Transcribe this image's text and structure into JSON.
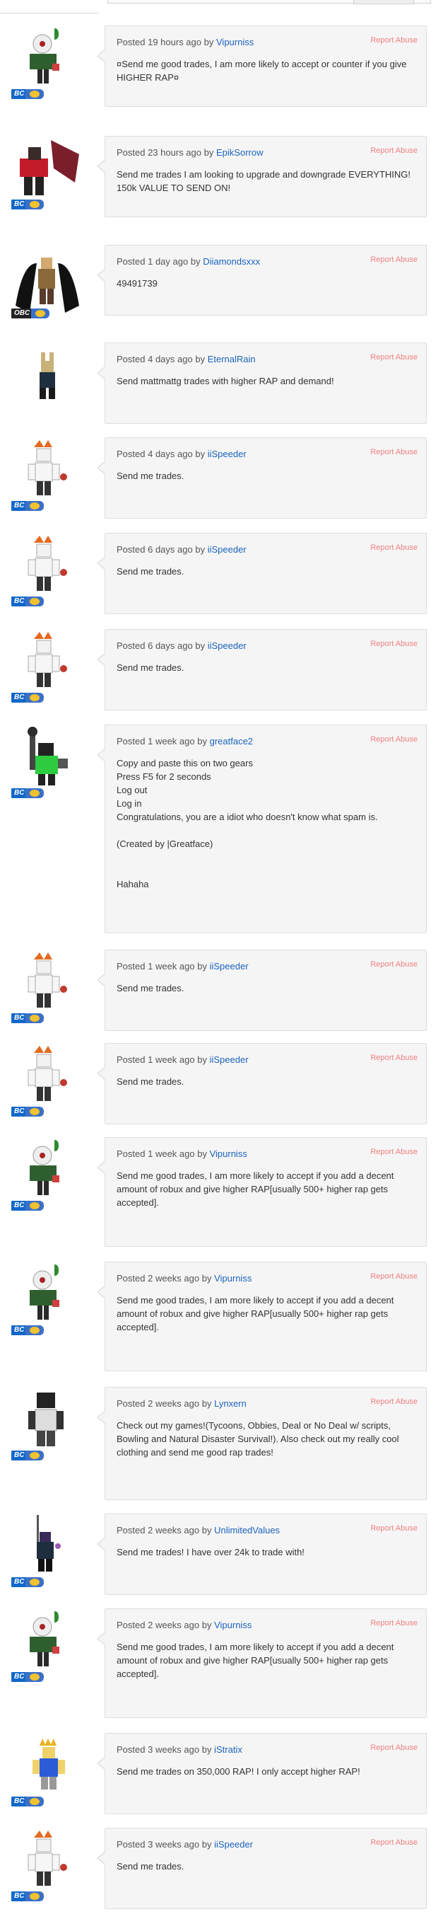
{
  "report_label": "Report Abuse",
  "posted_prefix": "Posted",
  "by_word": "by",
  "posts": [
    {
      "time": "19 hours ago",
      "user": "Vipurniss",
      "badge": "BC",
      "message": "¤Send me good trades, I am more likely to accept or counter if you give HIGHER RAP¤"
    },
    {
      "time": "23 hours ago",
      "user": "EpikSorrow",
      "badge": "BC",
      "message": "Send me trades I am looking to upgrade and downgrade EVERYTHING! 150k VALUE TO SEND ON!"
    },
    {
      "time": "1 day ago",
      "user": "Diiamondsxxx",
      "badge": "OBC",
      "message": "49491739"
    },
    {
      "time": "4 days ago",
      "user": "EternalRain",
      "badge": "",
      "message": "Send mattmattg trades with higher RAP and demand!"
    },
    {
      "time": "4 days ago",
      "user": "iiSpeeder",
      "badge": "BC",
      "message": "Send me trades."
    },
    {
      "time": "6 days ago",
      "user": "iiSpeeder",
      "badge": "BC",
      "message": "Send me trades."
    },
    {
      "time": "6 days ago",
      "user": "iiSpeeder",
      "badge": "BC",
      "message": "Send me trades."
    },
    {
      "time": "1 week ago",
      "user": "greatface2",
      "badge": "BC",
      "message": "Copy and paste this on two gears\nPress F5 for 2 seconds\nLog out\nLog in\nCongratulations, you are a idiot who doesn't know what spam is.\n\n(Created by |Greatface)\n\n\nHahaha"
    },
    {
      "time": "1 week ago",
      "user": "iiSpeeder",
      "badge": "BC",
      "message": "Send me trades."
    },
    {
      "time": "1 week ago",
      "user": "iiSpeeder",
      "badge": "BC",
      "message": "Send me trades."
    },
    {
      "time": "1 week ago",
      "user": "Vipurniss",
      "badge": "BC",
      "message": "Send me good trades, I am more likely to accept if you add a decent amount of robux and give higher RAP[usually 500+ higher rap gets accepted]."
    },
    {
      "time": "2 weeks ago",
      "user": "Vipurniss",
      "badge": "BC",
      "message": "Send me good trades, I am more likely to accept if you add a decent amount of robux and give higher RAP[usually 500+ higher rap gets accepted]."
    },
    {
      "time": "2 weeks ago",
      "user": "Lynxern",
      "badge": "BC",
      "message": "Check out my games!(Tycoons, Obbies, Deal or No Deal w/ scripts, Bowling and Natural Disaster Survival!). Also check out my really cool clothing and send me good rap trades!"
    },
    {
      "time": "2 weeks ago",
      "user": "UnlimitedValues",
      "badge": "BC",
      "message": "Send me trades! I have over 24k to trade with!"
    },
    {
      "time": "2 weeks ago",
      "user": "Vipurniss",
      "badge": "BC",
      "message": "Send me good trades, I am more likely to accept if you add a decent amount of robux and give higher RAP[usually 500+ higher rap gets accepted]."
    },
    {
      "time": "3 weeks ago",
      "user": "iStratix",
      "badge": "BC",
      "message": "Send me trades on 350,000 RAP! I only accept higher RAP!"
    },
    {
      "time": "3 weeks ago",
      "user": "iiSpeeder",
      "badge": "BC",
      "message": "Send me trades."
    }
  ]
}
